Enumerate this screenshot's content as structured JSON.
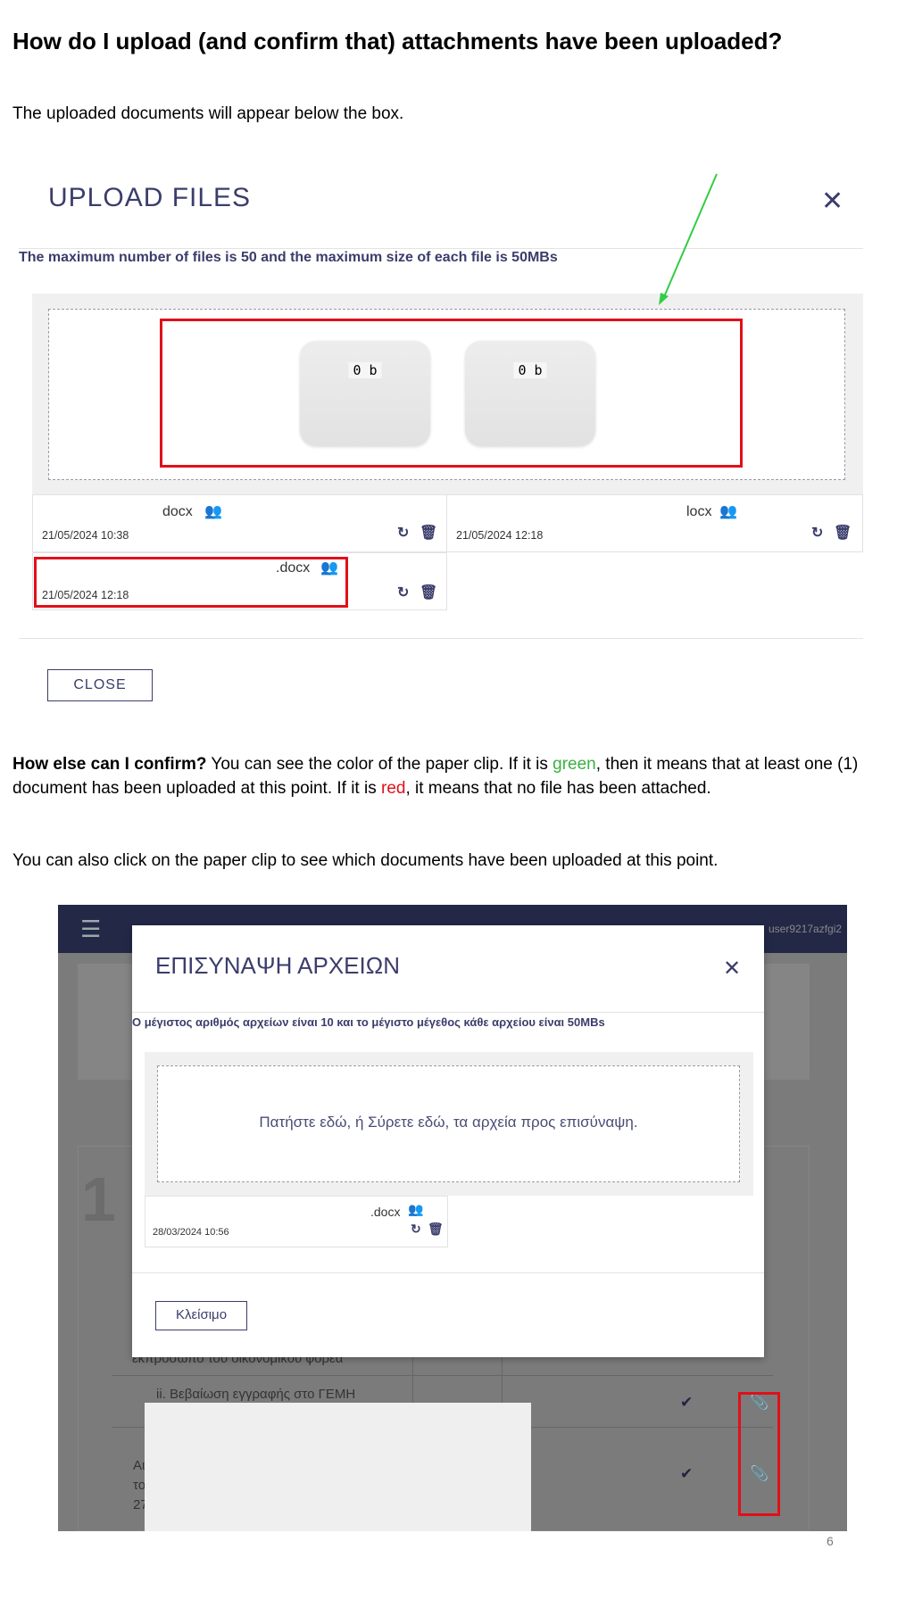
{
  "heading": "How do I upload (and confirm that) attachments have been uploaded?",
  "intro": "The uploaded documents will appear below the box.",
  "upload_modal": {
    "title": "UPLOAD FILES",
    "limit_text": "The maximum number of files is 50 and the maximum size of each file is 50MBs",
    "tiles": [
      {
        "size": "0 b"
      },
      {
        "size": "0 b"
      }
    ],
    "files": [
      {
        "name": "docx",
        "date": "21/05/2024 10:38"
      },
      {
        "name": "locx",
        "date": "21/05/2024 12:18"
      },
      {
        "name": ".docx",
        "date": "21/05/2024 12:18"
      }
    ],
    "close_label": "CLOSE",
    "arrow_color": "#33cc44",
    "highlight_color": "#e0101a"
  },
  "confirm": {
    "bold": "How else can I confirm?",
    "part1": " You can see the color of the paper clip. If it is ",
    "green": "green",
    "part2": ", then it means that at least one (1) document has been uploaded at this point. If it is ",
    "red": "red",
    "part3": ", it means that no file has been attached.",
    "green_color": "#3cb043",
    "red_color": "#e0101a"
  },
  "click_text": "You can also click on the paper clip to see which documents have been uploaded at this point.",
  "greek_app": {
    "user": "user9217azfgi2",
    "big_number": "1",
    "modal": {
      "title": "ΕΠΙΣΥΝΑΨΗ ΑΡΧΕΙΩΝ",
      "limit_text": "Ο μέγιστος αριθμός αρχείων είναι 10 και το μέγιστο μέγεθος κάθε αρχείου είναι 50MBs",
      "dropzone": "Πατήστε εδώ, ή Σύρετε εδώ, τα αρχεία προς επισύναψη.",
      "file": {
        "name": ".docx",
        "date": "28/03/2024 10:56"
      },
      "close_label": "Κλείσιμο"
    },
    "rows": [
      {
        "text": "εκπροσωπο του οικονομικου φορεα"
      },
      {
        "text": "ii. Βεβαίωση εγγραφής στο ΓΕΜΗ",
        "clip": "red"
      },
      {
        "text": "Αι το 27",
        "clip": "green"
      }
    ]
  },
  "page_number": "6"
}
